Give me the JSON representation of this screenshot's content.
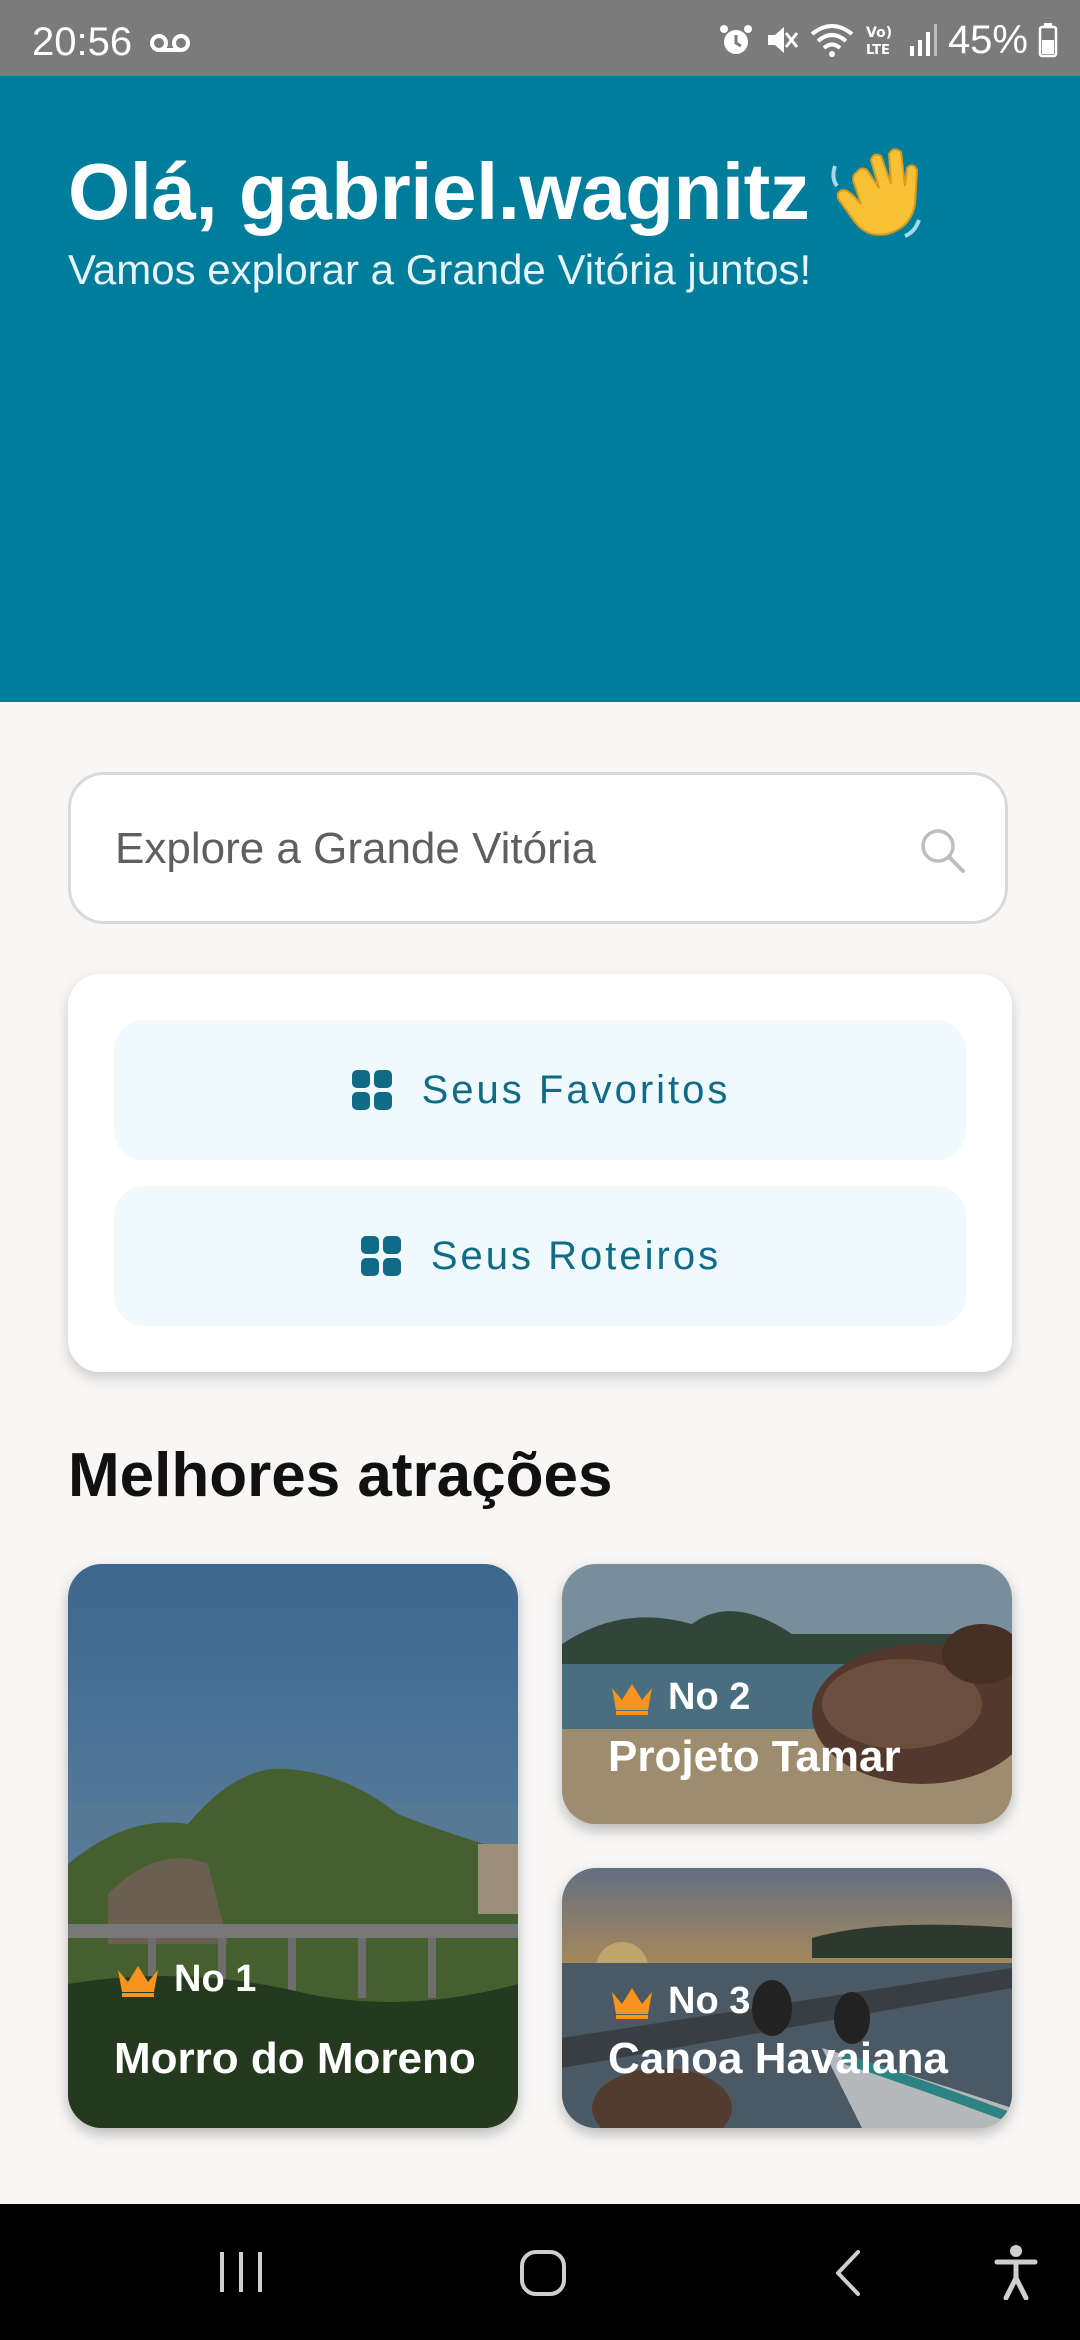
{
  "status_bar": {
    "time": "20:56",
    "battery": "45%",
    "icons": [
      "voicemail-icon",
      "alarm-icon",
      "mute-icon",
      "wifi-icon",
      "volte-icon",
      "signal-icon",
      "battery-icon"
    ]
  },
  "header": {
    "greeting": "Olá, gabriel.wagnitz",
    "subtitle": "Vamos explorar a Grande Vitória juntos!",
    "emoji": "waving-hand-icon",
    "background_color": "#017d9c"
  },
  "search": {
    "placeholder": "Explore a Grande Vitória",
    "icon": "search-icon"
  },
  "quick_actions": [
    {
      "label": "Seus Favoritos",
      "icon": "grid-icon"
    },
    {
      "label": "Seus Roteiros",
      "icon": "grid-icon"
    }
  ],
  "section": {
    "title": "Melhores atrações"
  },
  "attractions": [
    {
      "rank": "No 1",
      "name": "Morro do Moreno"
    },
    {
      "rank": "No 2",
      "name": "Projeto Tamar"
    },
    {
      "rank": "No 3",
      "name": "Canoa Havaiana"
    }
  ],
  "nav_bar": {
    "buttons": [
      "recent-apps-icon",
      "home-icon",
      "back-icon",
      "accessibility-icon"
    ]
  }
}
